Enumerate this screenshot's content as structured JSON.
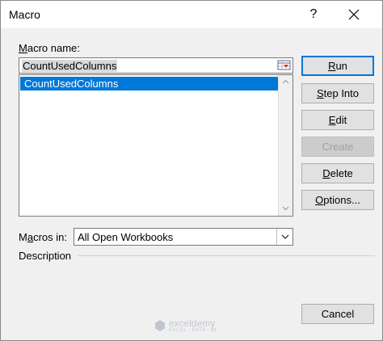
{
  "window": {
    "title": "Macro",
    "help_label": "?"
  },
  "macro_name": {
    "label_accel": "M",
    "label_rest": "acro name:",
    "value": "CountUsedColumns"
  },
  "macro_list": {
    "items": [
      "CountUsedColumns"
    ],
    "selected_index": 0
  },
  "macros_in": {
    "label_pre": "M",
    "label_accel": "a",
    "label_rest": "cros in:",
    "selected": "All Open Workbooks"
  },
  "description": {
    "label": "Description"
  },
  "buttons": {
    "run": {
      "accel": "R",
      "rest": "un"
    },
    "step_into": {
      "accel": "S",
      "rest": "tep Into"
    },
    "edit": {
      "accel": "E",
      "rest": "dit"
    },
    "create": {
      "accel": "",
      "rest": "Create",
      "disabled": true
    },
    "delete": {
      "accel": "D",
      "rest": "elete"
    },
    "options": {
      "accel": "O",
      "rest": "ptions..."
    },
    "cancel": {
      "label": "Cancel"
    }
  },
  "watermark": {
    "name": "exceldemy",
    "tagline": "EXCEL · DATA · BI"
  },
  "colors": {
    "selection": "#0078d7",
    "default_button_border": "#0078d7",
    "dialog_bg": "#f0f0f0"
  },
  "icons": {
    "help": "help-icon",
    "close": "close-icon",
    "reference": "cell-reference-icon",
    "scroll_up": "scroll-up-icon",
    "scroll_down": "scroll-down-icon",
    "dropdown": "chevron-down-icon"
  }
}
